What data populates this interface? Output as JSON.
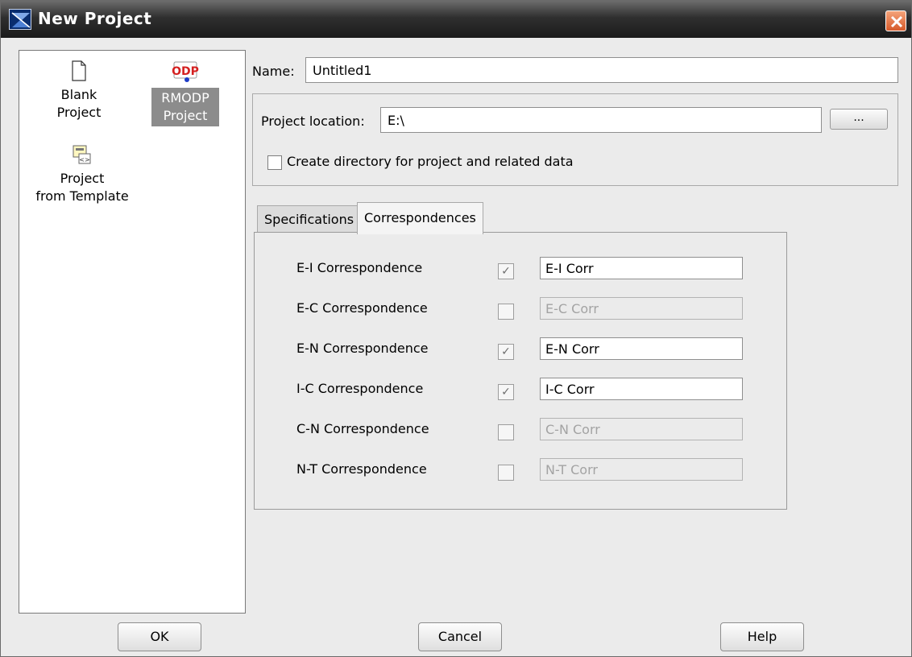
{
  "window": {
    "title": "New Project"
  },
  "left_panel": {
    "items": [
      {
        "label_line1": "Blank",
        "label_line2": "Project",
        "icon": "blank-page-icon",
        "selected": false
      },
      {
        "label_line1": "RMODP",
        "label_line2": "Project",
        "icon": "odp-icon",
        "icon_text": "ODP",
        "selected": true
      },
      {
        "label_line1": "Project",
        "label_line2": "from Template",
        "icon": "template-icon",
        "selected": false
      }
    ]
  },
  "form": {
    "name_label": "Name:",
    "name_value": "Untitled1",
    "location_label": "Project location:",
    "location_value": "E:\\",
    "browse_label": "...",
    "create_dir_label": "Create directory for project and related data",
    "create_dir_checked": false
  },
  "tabs": {
    "items": [
      {
        "label": "Specifications",
        "active": false
      },
      {
        "label": "Correspondences",
        "active": true
      }
    ]
  },
  "correspondences": [
    {
      "label": "E-I Correspondence",
      "checked": true,
      "value": "E-I Corr"
    },
    {
      "label": "E-C Correspondence",
      "checked": false,
      "value": "E-C Corr"
    },
    {
      "label": "E-N Correspondence",
      "checked": true,
      "value": "E-N Corr"
    },
    {
      "label": "I-C Correspondence",
      "checked": true,
      "value": "I-C Corr"
    },
    {
      "label": "C-N Correspondence",
      "checked": false,
      "value": "C-N Corr"
    },
    {
      "label": "N-T Correspondence",
      "checked": false,
      "value": "N-T Corr"
    }
  ],
  "buttons": {
    "ok": "OK",
    "cancel": "Cancel",
    "help": "Help"
  },
  "colors": {
    "titlebar": "#1b1b1b",
    "selected_tile": "#8c8c8c",
    "close_button": "#d65a2a",
    "odp_red": "#d42020",
    "odp_blue": "#1d3bc7"
  }
}
